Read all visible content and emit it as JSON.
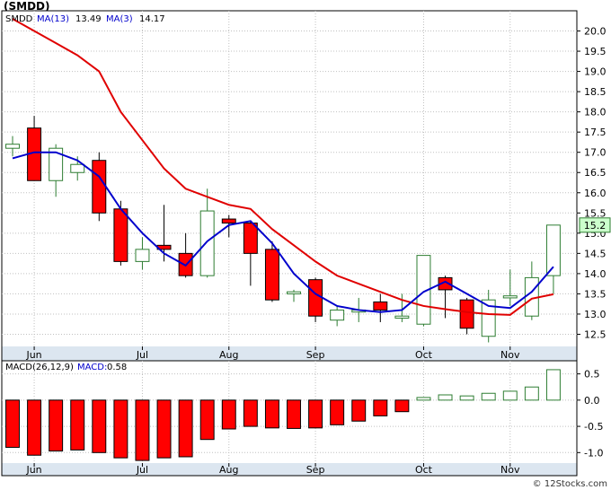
{
  "title": "(SMDD)",
  "credit": "© 12Stocks.com",
  "legend_top": {
    "symbol": "SMDD",
    "ma13_label": "MA(13)",
    "ma13_value": "13.49",
    "ma3_label": "MA(3)",
    "ma3_value": "14.17"
  },
  "legend_bottom": {
    "macd_params": "MACD(26,12,9)",
    "macd_label": "MACD:",
    "macd_value": "0.58"
  },
  "last_price_label": "15.2",
  "colors": {
    "up": "#2e7d32",
    "down": "#ff0000",
    "ma13": "#e00000",
    "ma3": "#0000cc",
    "grid": "#c0c0c0",
    "axis_band": "#dce6f0"
  },
  "chart_data": [
    {
      "type": "candlestick",
      "x_tick_labels": [
        "Jun",
        "Jul",
        "Aug",
        "Sep",
        "Oct",
        "Nov"
      ],
      "x_tick_index": [
        1,
        6,
        10,
        14,
        19,
        23
      ],
      "y_ticks": [
        12.5,
        13.0,
        13.5,
        14.0,
        14.5,
        15.0,
        15.5,
        16.0,
        16.5,
        17.0,
        17.5,
        18.0,
        18.5,
        19.0,
        19.5,
        20.0
      ],
      "ylim": [
        12.2,
        20.5
      ],
      "ohlc": [
        [
          17.1,
          17.4,
          16.9,
          17.2
        ],
        [
          17.6,
          17.9,
          16.3,
          16.3
        ],
        [
          16.3,
          17.2,
          15.9,
          17.1
        ],
        [
          16.5,
          16.9,
          16.3,
          16.7
        ],
        [
          16.8,
          17.0,
          15.3,
          15.5
        ],
        [
          15.6,
          15.8,
          14.2,
          14.3
        ],
        [
          14.3,
          14.9,
          14.1,
          14.6
        ],
        [
          14.7,
          15.7,
          14.3,
          14.6
        ],
        [
          14.5,
          15.0,
          13.9,
          13.95
        ],
        [
          13.95,
          16.1,
          13.9,
          15.55
        ],
        [
          15.35,
          15.45,
          14.9,
          15.25
        ],
        [
          15.25,
          15.3,
          13.7,
          14.5
        ],
        [
          14.6,
          14.8,
          13.3,
          13.35
        ],
        [
          13.5,
          13.6,
          13.3,
          13.55
        ],
        [
          13.85,
          13.9,
          12.8,
          12.95
        ],
        [
          12.85,
          13.2,
          12.7,
          13.1
        ],
        [
          13.05,
          13.4,
          12.8,
          13.1
        ],
        [
          13.3,
          13.5,
          12.8,
          13.1
        ],
        [
          12.9,
          13.5,
          12.8,
          12.95
        ],
        [
          12.75,
          14.45,
          12.7,
          14.45
        ],
        [
          13.9,
          13.95,
          12.9,
          13.6
        ],
        [
          13.35,
          13.4,
          12.5,
          12.65
        ],
        [
          12.45,
          13.6,
          12.3,
          13.35
        ],
        [
          13.4,
          14.1,
          13.2,
          13.45
        ],
        [
          12.95,
          14.3,
          12.85,
          13.9
        ],
        [
          13.95,
          15.2,
          13.5,
          15.2
        ]
      ],
      "ma13": [
        20.3,
        20.0,
        19.7,
        19.4,
        19.0,
        18.0,
        17.3,
        16.6,
        16.1,
        15.9,
        15.7,
        15.6,
        15.1,
        14.7,
        14.3,
        13.95,
        13.75,
        13.55,
        13.35,
        13.2,
        13.12,
        13.05,
        13.0,
        12.98,
        13.38,
        13.49
      ],
      "ma3": [
        16.85,
        17.0,
        17.0,
        16.8,
        16.4,
        15.6,
        15.0,
        14.5,
        14.2,
        14.8,
        15.2,
        15.3,
        14.75,
        14.0,
        13.5,
        13.2,
        13.1,
        13.05,
        13.1,
        13.55,
        13.8,
        13.5,
        13.2,
        13.15,
        13.55,
        14.17
      ]
    },
    {
      "type": "bar",
      "series": [
        {
          "name": "MACD",
          "values": [
            -0.9,
            -1.05,
            -0.97,
            -0.95,
            -1.0,
            -1.1,
            -1.15,
            -1.1,
            -1.08,
            -0.75,
            -0.55,
            -0.5,
            -0.53,
            -0.54,
            -0.53,
            -0.47,
            -0.4,
            -0.3,
            -0.22,
            0.05,
            0.1,
            0.08,
            0.13,
            0.17,
            0.25,
            0.58
          ]
        }
      ],
      "y_ticks": [
        0.5,
        0.0,
        -0.5,
        -1.0
      ],
      "y_tick_labels": [
        "0.5",
        "0.0",
        "-0.5",
        "-1.0"
      ],
      "ylim": [
        -1.2,
        0.75
      ],
      "x_tick_labels": [
        "Jun",
        "Jul",
        "Aug",
        "Sep",
        "Oct",
        "Nov"
      ],
      "x_tick_index": [
        1,
        6,
        10,
        14,
        19,
        23
      ]
    }
  ]
}
